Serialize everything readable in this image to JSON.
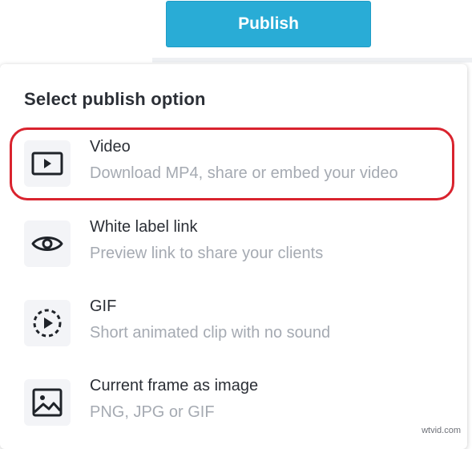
{
  "header": {
    "publish_label": "Publish"
  },
  "panel": {
    "title": "Select publish option",
    "options": [
      {
        "icon": "play-square-icon",
        "title": "Video",
        "description": "Download MP4, share or embed your video"
      },
      {
        "icon": "eye-icon",
        "title": "White label link",
        "description": "Preview link to share your clients"
      },
      {
        "icon": "dashed-play-circle-icon",
        "title": "GIF",
        "description": "Short animated clip with no sound"
      },
      {
        "icon": "image-icon",
        "title": "Current frame as image",
        "description": "PNG, JPG or GIF"
      }
    ]
  },
  "annotation": {
    "highlight_color": "#d9232e"
  },
  "watermark": "wtvid.com",
  "colors": {
    "accent": "#29acd6",
    "title_text": "#2b2f36",
    "muted_text": "#a5aab2",
    "icon_bg": "#f3f4f7"
  }
}
